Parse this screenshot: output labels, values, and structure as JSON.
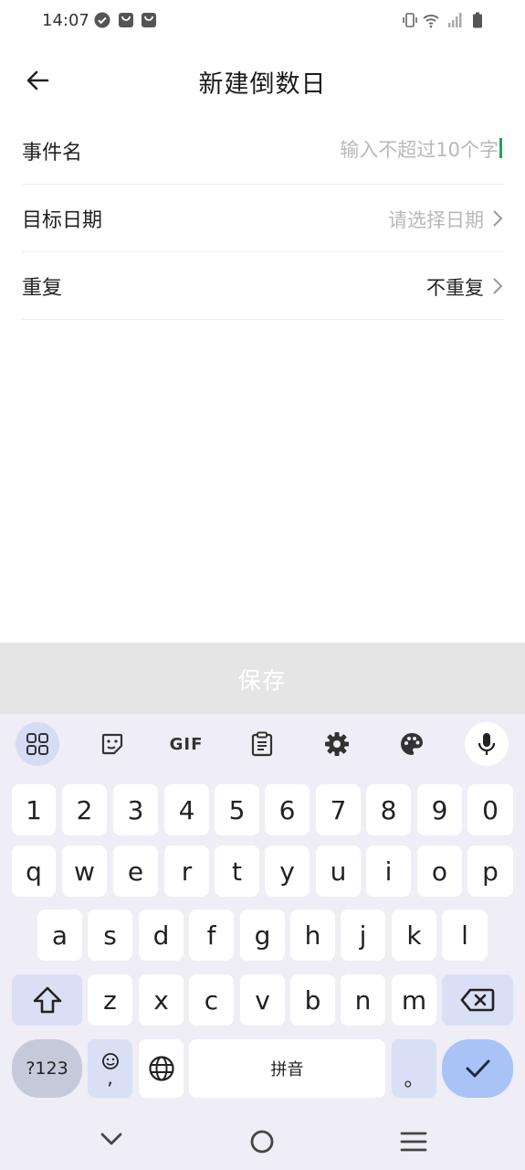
{
  "status_bar": {
    "time": "14:07"
  },
  "header": {
    "title": "新建倒数日"
  },
  "form": {
    "event_name": {
      "label": "事件名",
      "placeholder": "输入不超过10个字",
      "value": ""
    },
    "target_date": {
      "label": "目标日期",
      "value": "请选择日期"
    },
    "repeat": {
      "label": "重复",
      "value": "不重复"
    }
  },
  "save_button": {
    "label": "保存"
  },
  "keyboard": {
    "row_numbers": [
      "1",
      "2",
      "3",
      "4",
      "5",
      "6",
      "7",
      "8",
      "9",
      "0"
    ],
    "row_1": [
      "q",
      "w",
      "e",
      "r",
      "t",
      "y",
      "u",
      "i",
      "o",
      "p"
    ],
    "row_2": [
      "a",
      "s",
      "d",
      "f",
      "g",
      "h",
      "j",
      "k",
      "l"
    ],
    "row_3": [
      "z",
      "x",
      "c",
      "v",
      "b",
      "n",
      "m"
    ],
    "symbols_key": "?123",
    "emoji_key_sub": ",",
    "space_label": "拼音",
    "period_key": "。",
    "gif_label": "GIF"
  },
  "icons": {
    "status": [
      "check-circle-icon",
      "bag-icon",
      "bag-icon",
      "vibrate-icon",
      "wifi-icon",
      "signal-icon",
      "battery-icon"
    ],
    "toolbar": [
      "apps-grid-icon",
      "sticker-icon",
      "gif-icon",
      "clipboard-icon",
      "settings-icon",
      "palette-icon",
      "mic-icon"
    ],
    "nav": [
      "nav-back-icon",
      "nav-home-icon",
      "nav-menu-icon"
    ]
  },
  "colors": {
    "accent": "#a9c3f6",
    "caret": "#1fa55a",
    "save_bar": "#e5e5e5",
    "keyboard_bg": "#efedf5"
  }
}
